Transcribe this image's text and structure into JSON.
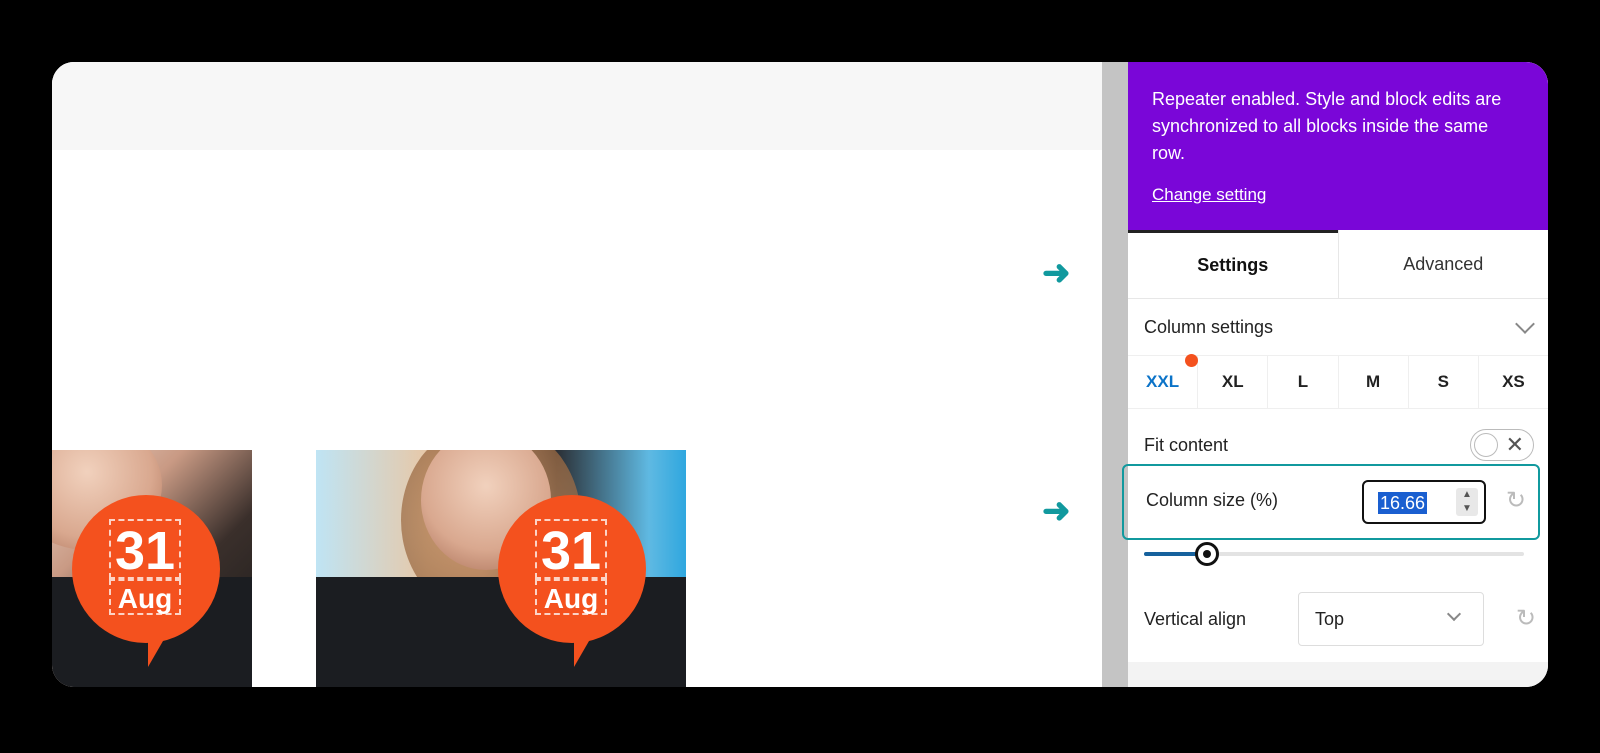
{
  "preview": {
    "cards": [
      {
        "day": "31",
        "month": "Aug"
      },
      {
        "day": "31",
        "month": "Aug"
      }
    ]
  },
  "panel": {
    "notice": {
      "text": "Repeater enabled. Style and block edits are synchronized to all blocks inside the same row.",
      "link": "Change setting"
    },
    "tabs": [
      {
        "label": "Settings",
        "active": true
      },
      {
        "label": "Advanced",
        "active": false
      }
    ],
    "section_title": "Column settings",
    "breakpoints": [
      "XXL",
      "XL",
      "L",
      "M",
      "S",
      "XS"
    ],
    "active_breakpoint": "XXL",
    "fit_content": {
      "label": "Fit content",
      "enabled": false
    },
    "column_size": {
      "label": "Column size (%)",
      "value": "16.66"
    },
    "slider_value_percent": 16.66,
    "vertical_align": {
      "label": "Vertical align",
      "value": "Top"
    }
  },
  "colors": {
    "notice_bg": "#7a06d8",
    "accent_teal": "#11999e",
    "badge_orange": "#f4511e",
    "active_breakpoint": "#0b73c8"
  },
  "icons": [
    "arrow-right-icon",
    "chevron-down-icon",
    "close-icon",
    "reset-icon",
    "spinner-arrows-icon"
  ]
}
